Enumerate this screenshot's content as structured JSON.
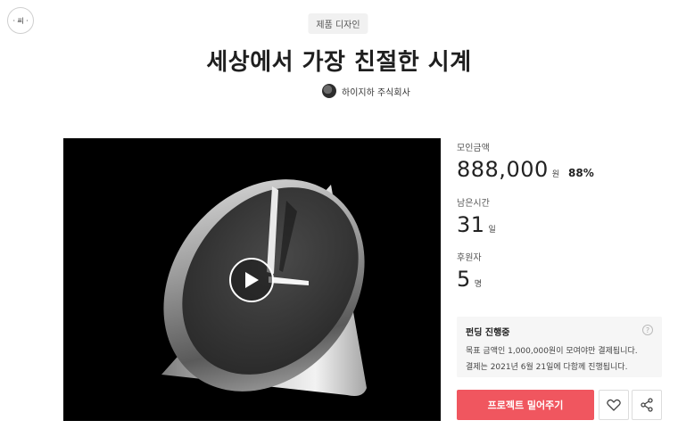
{
  "header": {
    "logo_text": "ㆍ씨ㆍ",
    "category": "제품 디자인",
    "title": "세상에서 가장 친절한 시계",
    "creator": "하이지하 주식회사"
  },
  "video": {
    "play_icon": "play-icon"
  },
  "stats": {
    "amount_label": "모인금액",
    "amount_value": "888,000",
    "amount_unit": "원",
    "amount_percent": "88%",
    "time_label": "남은시간",
    "time_value": "31",
    "time_unit": "일",
    "backers_label": "후원자",
    "backers_value": "5",
    "backers_unit": "명"
  },
  "funding": {
    "title": "펀딩 진행중",
    "line1": "목표 금액인 1,000,000원이 모여야만 결제됩니다.",
    "line2": "결제는 2021년 6월 21일에 다함께 진행됩니다.",
    "help_icon": "?"
  },
  "actions": {
    "support_label": "프로젝트 밀어주기",
    "like_icon": "heart-icon",
    "share_icon": "share-icon"
  },
  "colors": {
    "accent": "#f0565f",
    "video_bg": "#000000"
  }
}
